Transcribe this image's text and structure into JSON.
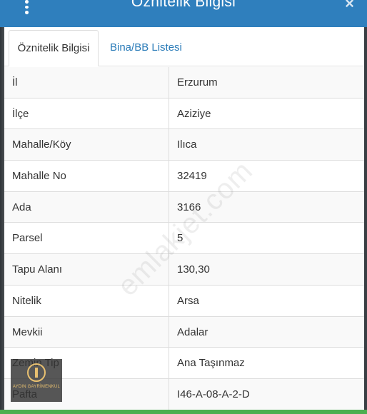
{
  "header": {
    "title": "Öznitelik Bilgisi",
    "close_symbol": "×",
    "menu_icon": "kebab-menu-icon"
  },
  "tabs": [
    {
      "label": "Öznitelik Bilgisi",
      "active": true
    },
    {
      "label": "Bina/BB Listesi",
      "active": false
    }
  ],
  "rows": [
    {
      "key": "İl",
      "value": "Erzurum"
    },
    {
      "key": "İlçe",
      "value": "Aziziye"
    },
    {
      "key": "Mahalle/Köy",
      "value": "Ilıca"
    },
    {
      "key": "Mahalle No",
      "value": "32419"
    },
    {
      "key": "Ada",
      "value": "3166"
    },
    {
      "key": "Parsel",
      "value": "5"
    },
    {
      "key": "Tapu Alanı",
      "value": "130,30"
    },
    {
      "key": "Nitelik",
      "value": "Arsa"
    },
    {
      "key": "Mevkii",
      "value": "Adalar"
    },
    {
      "key": "Zemin Tip",
      "value": "Ana Taşınmaz"
    },
    {
      "key": "Pafta",
      "value": "I46-A-08-A-2-D"
    }
  ],
  "watermark": "emlakjet.com",
  "logo": {
    "text": "AYDIN GAYRİMENKUL"
  },
  "colors": {
    "header": "#2f7fbd",
    "tab_link": "#2a7bb8",
    "bottom_bar": "#4caf50"
  }
}
